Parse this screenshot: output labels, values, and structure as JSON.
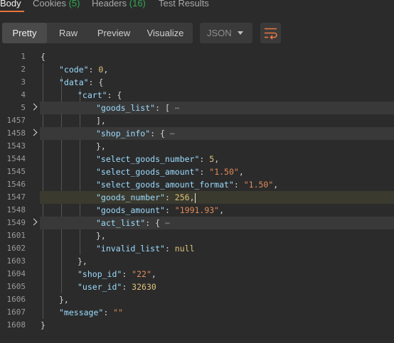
{
  "tabs": [
    {
      "label": "Body",
      "count": ""
    },
    {
      "label": "Cookies",
      "count": "(5)"
    },
    {
      "label": "Headers",
      "count": "(16)"
    },
    {
      "label": "Test Results",
      "count": ""
    }
  ],
  "view_modes": [
    "Pretty",
    "Raw",
    "Preview",
    "Visualize"
  ],
  "active_view_mode": "Pretty",
  "format_select": {
    "value": "JSON"
  },
  "icons": {
    "wrap": "wrap-lines-icon",
    "fold": "chevron-right-icon"
  },
  "code_lines": [
    {
      "num": "1",
      "tokens": [
        {
          "t": "p",
          "v": "{"
        }
      ]
    },
    {
      "num": "2",
      "tokens": [
        {
          "t": "k",
          "v": "\"code\""
        },
        {
          "t": "p",
          "v": ": "
        },
        {
          "t": "n",
          "v": "0"
        },
        {
          "t": "p",
          "v": ","
        }
      ]
    },
    {
      "num": "3",
      "tokens": [
        {
          "t": "k",
          "v": "\"data\""
        },
        {
          "t": "p",
          "v": ": {"
        }
      ]
    },
    {
      "num": "4",
      "tokens": [
        {
          "t": "k",
          "v": "\"cart\""
        },
        {
          "t": "p",
          "v": ": {"
        }
      ]
    },
    {
      "num": "5",
      "tokens": [
        {
          "t": "k",
          "v": "\"goods_list\""
        },
        {
          "t": "p",
          "v": ": [ "
        },
        {
          "t": "e",
          "v": "⋯"
        }
      ]
    },
    {
      "num": "1457",
      "tokens": [
        {
          "t": "p",
          "v": "],"
        }
      ]
    },
    {
      "num": "1458",
      "tokens": [
        {
          "t": "k",
          "v": "\"shop_info\""
        },
        {
          "t": "p",
          "v": ": { "
        },
        {
          "t": "e",
          "v": "⋯"
        }
      ]
    },
    {
      "num": "1543",
      "tokens": [
        {
          "t": "p",
          "v": "},"
        }
      ]
    },
    {
      "num": "1544",
      "tokens": [
        {
          "t": "k",
          "v": "\"select_goods_number\""
        },
        {
          "t": "p",
          "v": ": "
        },
        {
          "t": "n",
          "v": "5"
        },
        {
          "t": "p",
          "v": ","
        }
      ]
    },
    {
      "num": "1545",
      "tokens": [
        {
          "t": "k",
          "v": "\"select_goods_amount\""
        },
        {
          "t": "p",
          "v": ": "
        },
        {
          "t": "s",
          "v": "\"1.50\""
        },
        {
          "t": "p",
          "v": ","
        }
      ]
    },
    {
      "num": "1546",
      "tokens": [
        {
          "t": "k",
          "v": "\"select_goods_amount_format\""
        },
        {
          "t": "p",
          "v": ": "
        },
        {
          "t": "s",
          "v": "\"1.50\""
        },
        {
          "t": "p",
          "v": ","
        }
      ]
    },
    {
      "num": "1547",
      "tokens": [
        {
          "t": "k",
          "v": "\"goods_number\""
        },
        {
          "t": "p",
          "v": ": "
        },
        {
          "t": "n",
          "v": "256"
        },
        {
          "t": "p",
          "v": ","
        }
      ]
    },
    {
      "num": "1548",
      "tokens": [
        {
          "t": "k",
          "v": "\"goods_amount\""
        },
        {
          "t": "p",
          "v": ": "
        },
        {
          "t": "s",
          "v": "\"1991.93\""
        },
        {
          "t": "p",
          "v": ","
        }
      ]
    },
    {
      "num": "1549",
      "tokens": [
        {
          "t": "k",
          "v": "\"act_list\""
        },
        {
          "t": "p",
          "v": ": { "
        },
        {
          "t": "e",
          "v": "⋯"
        }
      ]
    },
    {
      "num": "1601",
      "tokens": [
        {
          "t": "p",
          "v": "},"
        }
      ]
    },
    {
      "num": "1602",
      "tokens": [
        {
          "t": "k",
          "v": "\"invalid_list\""
        },
        {
          "t": "p",
          "v": ": "
        },
        {
          "t": "n",
          "v": "null"
        }
      ]
    },
    {
      "num": "1603",
      "tokens": [
        {
          "t": "p",
          "v": "},"
        }
      ]
    },
    {
      "num": "1604",
      "tokens": [
        {
          "t": "k",
          "v": "\"shop_id\""
        },
        {
          "t": "p",
          "v": ": "
        },
        {
          "t": "s",
          "v": "\"22\""
        },
        {
          "t": "p",
          "v": ","
        }
      ]
    },
    {
      "num": "1605",
      "tokens": [
        {
          "t": "k",
          "v": "\"user_id\""
        },
        {
          "t": "p",
          "v": ": "
        },
        {
          "t": "n",
          "v": "32630"
        }
      ]
    },
    {
      "num": "1606",
      "tokens": [
        {
          "t": "p",
          "v": "},"
        }
      ]
    },
    {
      "num": "1607",
      "tokens": [
        {
          "t": "k",
          "v": "\"message\""
        },
        {
          "t": "p",
          "v": ": "
        },
        {
          "t": "s",
          "v": "\"\""
        }
      ]
    },
    {
      "num": "1608",
      "tokens": [
        {
          "t": "p",
          "v": "}"
        }
      ]
    }
  ],
  "colors": {
    "active_tab_underline": "#e8763f",
    "count": "#2fa84f",
    "wrap_icon": "#e8763f"
  }
}
